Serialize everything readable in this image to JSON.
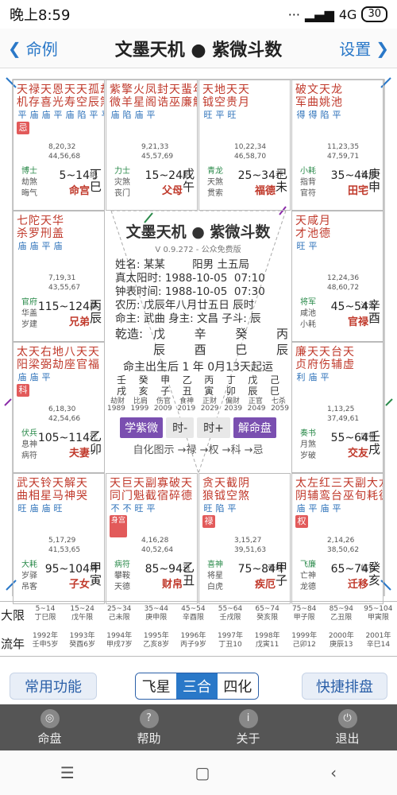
{
  "status": {
    "time": "晚上8:59",
    "signal": "4G",
    "battery": "30"
  },
  "titlebar": {
    "back_label": "命例",
    "title": "文墨天机 ● 紫微斗数",
    "settings_label": "设置"
  },
  "cells": [
    {
      "key": "si",
      "stars": [
        "天机",
        "禄存",
        "天喜",
        "恩光",
        "天寿",
        "天空",
        "孤辰",
        "劫煞"
      ],
      "brightness": "平庙庙平庙陷平平",
      "tag": "忌",
      "nums": [
        "8,20,32",
        "44,56,68"
      ],
      "stage": "绝",
      "row1": "博士",
      "row2": "劫煞",
      "row3": "晦气",
      "limit": "5~14",
      "palace": "命宫",
      "gz": "丁巳"
    },
    {
      "key": "wu",
      "stars": [
        "紫微",
        "擎羊",
        "火星",
        "凤阁",
        "封诰",
        "天巫",
        "蜚廉",
        "年解"
      ],
      "brightness": "庙陷庙平",
      "tag": "",
      "nums": [
        "9,21,33",
        "45,57,69"
      ],
      "stage": "胎",
      "row1": "力士",
      "row2": "灾煞",
      "row3": "丧门",
      "limit": "15~24",
      "palace": "父母",
      "gz": "戊午"
    },
    {
      "key": "wei",
      "stars": [
        "天钺",
        "地空",
        "天贵",
        "天月"
      ],
      "brightness": "旺平旺",
      "tag": "",
      "nums": [
        "10,22,34",
        "46,58,70"
      ],
      "stage": "养",
      "row1": "青龙",
      "row2": "天煞",
      "row3": "贯索",
      "limit": "25~34",
      "palace": "福德",
      "gz": "己未"
    },
    {
      "key": "shen",
      "stars": [
        "破军",
        "文曲",
        "天姚",
        "龙池"
      ],
      "brightness": "得得陷平",
      "tag": "",
      "nums": [
        "11,23,35",
        "47,59,71"
      ],
      "stage": "长生",
      "row1": "小耗",
      "row2": "指背",
      "row3": "官符",
      "limit": "35~44",
      "palace": "田宅",
      "gz": "庚申"
    },
    {
      "key": "chen",
      "stars": [
        "七杀",
        "陀罗",
        "天刑",
        "华盖"
      ],
      "brightness": "庙庙平庙",
      "tag": "",
      "nums": [
        "7,19,31",
        "43,55,67"
      ],
      "stage": "墓",
      "row1": "官府",
      "row2": "华盖",
      "row3": "岁建",
      "limit": "115~124",
      "palace": "兄弟",
      "gz": "丙辰"
    },
    {
      "key": "you",
      "stars": [
        "天才",
        "咸池",
        "月德"
      ],
      "brightness": "旺平",
      "tag": "",
      "nums": [
        "12,24,36",
        "48,60,72"
      ],
      "stage": "沐浴",
      "row1": "将军",
      "row2": "咸池",
      "row3": "小耗",
      "limit": "45~54",
      "palace": "官禄",
      "gz": "辛酉"
    },
    {
      "key": "mao",
      "stars": [
        "太阳",
        "天梁",
        "右弼",
        "地劫",
        "八座",
        "天官",
        "天福"
      ],
      "brightness": "庙庙平",
      "tag": "科",
      "nums": [
        "6,18,30",
        "42,54,66"
      ],
      "stage": "死",
      "row1": "伏兵",
      "row2": "息神",
      "row3": "病符",
      "limit": "105~114",
      "palace": "夫妻",
      "gz": "乙卯"
    },
    {
      "key": "xu",
      "stars": [
        "廉贞",
        "天府",
        "天伤",
        "台辅",
        "天虚"
      ],
      "brightness": "利庙平",
      "tag": "",
      "nums": [
        "1,13,25",
        "37,49,61"
      ],
      "stage": "冠带",
      "row1": "奏书",
      "row2": "月煞",
      "row3": "岁破",
      "limit": "55~64",
      "palace": "交友",
      "gz": "壬戌"
    },
    {
      "key": "yin",
      "stars": [
        "武曲",
        "天相",
        "铃星",
        "天马",
        "解神",
        "天哭"
      ],
      "brightness": "旺庙庙旺",
      "tag": "",
      "nums": [
        "5,17,29",
        "41,53,65"
      ],
      "stage": "病",
      "row1": "大耗",
      "row2": "岁驿",
      "row3": "吊客",
      "limit": "95~104",
      "palace": "子女",
      "gz": "甲寅"
    },
    {
      "key": "chou",
      "stars": [
        "天同",
        "巨门",
        "天魁",
        "副截",
        "寡宿",
        "破碎",
        "天德"
      ],
      "brightness": "不不旺平",
      "tag": "身宫",
      "nums": [
        "4,16,28",
        "40,52,64"
      ],
      "stage": "衰",
      "row1": "病符",
      "row2": "攀鞍",
      "row3": "天德",
      "limit": "85~94",
      "palace": "财帛",
      "gz": "乙丑"
    },
    {
      "key": "zi",
      "stars": [
        "贪狼",
        "天钺",
        "截空",
        "阴煞"
      ],
      "brightness": "旺陷平",
      "tag": "禄",
      "nums": [
        "3,15,27",
        "39,51,63"
      ],
      "stage": "帝旺",
      "row1": "喜神",
      "row2": "将星",
      "row3": "白虎",
      "limit": "75~84",
      "palace": "疾厄",
      "gz": "甲子"
    },
    {
      "key": "hai",
      "stars": [
        "太阴",
        "左辅",
        "红鸾",
        "三台",
        "天巫",
        "副旬",
        "大耗",
        "龙德"
      ],
      "brightness": "庙平庙平",
      "tag": "权",
      "nums": [
        "2,14,26",
        "38,50,62"
      ],
      "stage": "临官",
      "row1": "飞廉",
      "row2": "亡神",
      "row3": "龙德",
      "limit": "65~74",
      "palace": "迁移",
      "gz": "癸亥"
    }
  ],
  "center": {
    "title": "文墨天机 ● 紫微斗数",
    "version": "V 0.9.272 - 公众免费版",
    "lines": [
      "姓名: 某某        阳男 土五局",
      "真太阳时: 1988-10-05  07:10",
      "钟表时间: 1988-10-05  07:30",
      "农历: 戊辰年八月廿五日 辰时",
      "命主: 武曲 身主: 文昌 子斗: 辰"
    ],
    "bazi_label": "乾造:",
    "bazi_top": [
      "戊",
      "辛",
      "癸",
      "丙"
    ],
    "bazi_bottom": [
      "辰",
      "酉",
      "巳",
      "辰"
    ],
    "qiyun": "命主出生后 1 年 0月13天起运",
    "dayun_stems": [
      "壬",
      "癸",
      "甲",
      "乙",
      "丙",
      "丁",
      "戊",
      "己"
    ],
    "dayun_branches": [
      "戌",
      "亥",
      "子",
      "丑",
      "寅",
      "卯",
      "辰",
      "巳"
    ],
    "ten_gods": [
      "劫财",
      "比肩",
      "伤官",
      "食神",
      "正财",
      "偏财",
      "正官",
      "七杀"
    ],
    "years": [
      "1989",
      "1999",
      "2009",
      "2019",
      "2029",
      "2039",
      "2049",
      "2059"
    ],
    "btn_learn": "学紫微",
    "btn_time_minus": "时-",
    "btn_time_plus": "时+",
    "btn_explain": "解命盘",
    "sihua": "自化图示 →禄 →权 →科 →忌"
  },
  "decades": {
    "row1_label": "大限",
    "row2_label": "流年",
    "row1": [
      [
        "5~14",
        "丁巳限"
      ],
      [
        "15~24",
        "戊午限"
      ],
      [
        "25~34",
        "己未限"
      ],
      [
        "35~44",
        "庚申限"
      ],
      [
        "45~54",
        "辛酉限"
      ],
      [
        "55~64",
        "壬戌限"
      ],
      [
        "65~74",
        "癸亥限"
      ],
      [
        "75~84",
        "甲子限"
      ],
      [
        "85~94",
        "乙丑限"
      ],
      [
        "95~104",
        "甲寅限"
      ]
    ],
    "row2": [
      [
        "1992年",
        "壬申5岁"
      ],
      [
        "1993年",
        "癸酉6岁"
      ],
      [
        "1994年",
        "甲戌7岁"
      ],
      [
        "1995年",
        "乙亥8岁"
      ],
      [
        "1996年",
        "丙子9岁"
      ],
      [
        "1997年",
        "丁丑10"
      ],
      [
        "1998年",
        "戊寅11"
      ],
      [
        "1999年",
        "己卯12"
      ],
      [
        "2000年",
        "庚辰13"
      ],
      [
        "2001年",
        "辛巳14"
      ]
    ]
  },
  "controls": {
    "common": "常用功能",
    "seg": [
      "飞星",
      "三合",
      "四化"
    ],
    "seg_active": 1,
    "quick": "快捷排盘"
  },
  "tabs": [
    {
      "label": "命盘",
      "icon": "chart-icon"
    },
    {
      "label": "帮助",
      "icon": "help-icon"
    },
    {
      "label": "关于",
      "icon": "info-icon"
    },
    {
      "label": "退出",
      "icon": "exit-icon"
    }
  ],
  "navbar": {
    "menu": "☰",
    "home": "▢",
    "back": "‹"
  }
}
